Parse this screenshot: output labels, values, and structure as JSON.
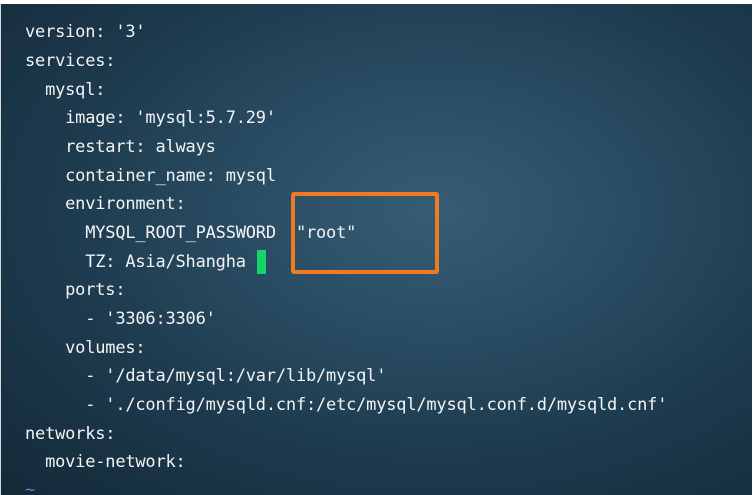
{
  "editor": {
    "lines": [
      "version: '3'",
      "services:",
      "  mysql:",
      "    image: 'mysql:5.7.29'",
      "    restart: always",
      "    container_name: mysql",
      "    environment:",
      "      MYSQL_ROOT_PASSWORD  \"root\"",
      "      TZ: Asia/Shangha",
      "    ports:",
      "      - '3306:3306'",
      "    volumes:",
      "      - '/data/mysql:/var/lib/mysql'",
      "      - './config/mysqld.cnf:/etc/mysql/mysql.conf.d/mysqld.cnf'",
      "networks:",
      "  movie-network:"
    ],
    "empty_line_marker": "~"
  },
  "colors": {
    "text": "#f2f4f5",
    "cursor": "#14d46a",
    "highlight": "#f07a22",
    "tilde": "#5a7fe0"
  }
}
